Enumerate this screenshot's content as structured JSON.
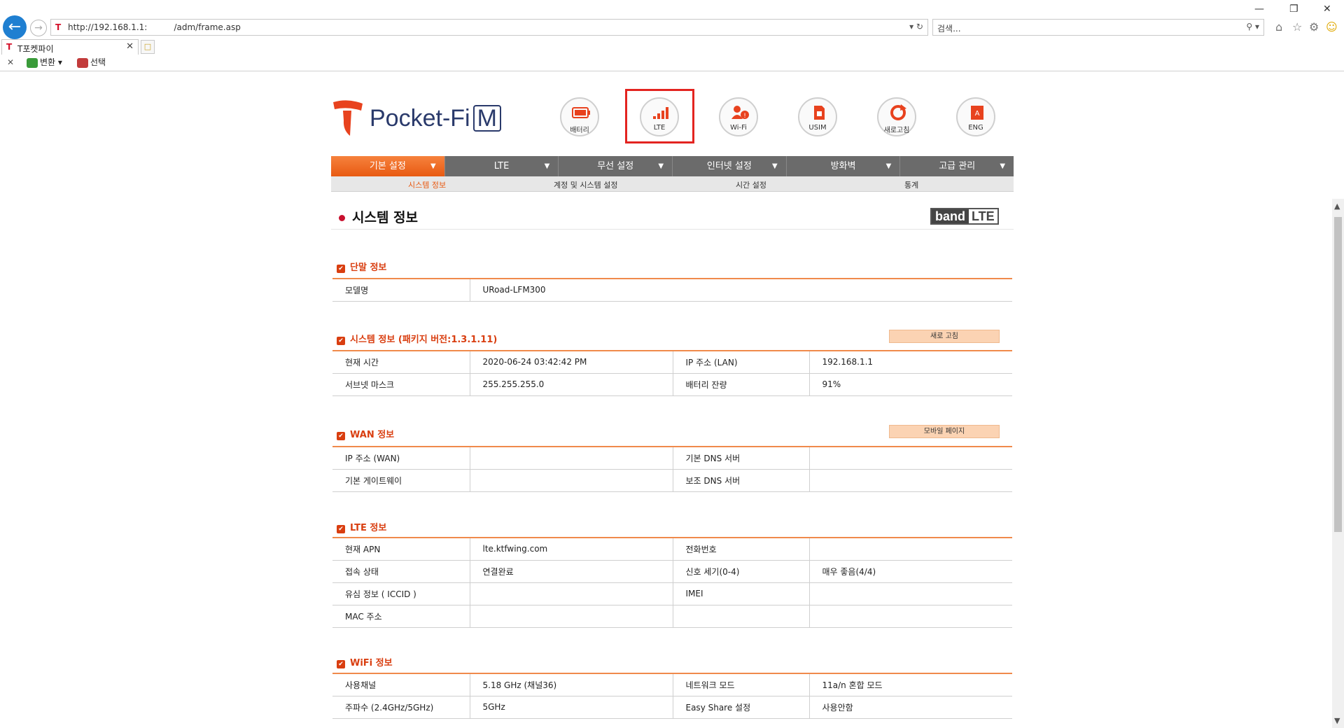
{
  "browser": {
    "url": "http://192.168.1.1:          /adm/frame.asp",
    "search_placeholder": "검색...",
    "tab_title": "T포켓파이",
    "cmd_convert": "변환",
    "cmd_select": "선택"
  },
  "header": {
    "brand": "Pocket-Fi",
    "brand_suffix": "M",
    "quick_icons": [
      {
        "label": "배터리",
        "icon": "battery-icon"
      },
      {
        "label": "LTE",
        "icon": "signal-icon"
      },
      {
        "label": "Wi-Fi",
        "icon": "wifi-users-icon"
      },
      {
        "label": "USIM",
        "icon": "sim-card-icon"
      },
      {
        "label": "새로고침",
        "icon": "refresh-icon"
      },
      {
        "label": "ENG",
        "icon": "language-icon"
      }
    ]
  },
  "nav": {
    "items": [
      "기본 설정",
      "LTE",
      "무선 설정",
      "인터넷 설정",
      "방화벽",
      "고급 관리"
    ],
    "arrow": "▼",
    "sub_items": [
      "시스템 정보",
      "계정 및 시스템 설정",
      "시간 설정",
      "통계"
    ]
  },
  "page": {
    "title": "시스템 정보",
    "badge_band": "band",
    "badge_lte": "LTE"
  },
  "sections": {
    "device": {
      "title": "단말 정보",
      "rows": [
        [
          "모델명",
          "URoad-LFM300"
        ]
      ]
    },
    "system": {
      "title": "시스템 정보 (패키지 버전:1.3.1.11)",
      "button": "새로 고침",
      "rows": [
        [
          "현재 시간",
          "2020-06-24 03:42:42 PM",
          "IP 주소 (LAN)",
          "192.168.1.1"
        ],
        [
          "서브넷 마스크",
          "255.255.255.0",
          "배터리 잔량",
          "91%"
        ]
      ]
    },
    "wan": {
      "title": "WAN 정보",
      "button": "모바일 페이지",
      "rows": [
        [
          "IP 주소 (WAN)",
          "",
          "기본 DNS 서버",
          ""
        ],
        [
          "기본 게이트웨이",
          "",
          "보조 DNS 서버",
          ""
        ]
      ]
    },
    "lte": {
      "title": "LTE 정보",
      "rows": [
        [
          "현재 APN",
          "lte.ktfwing.com",
          "전화번호",
          ""
        ],
        [
          "접속 상태",
          "연결완료",
          "신호 세기(0-4)",
          "매우 좋음(4/4)"
        ],
        [
          "유심 정보 ( ICCID )",
          "",
          "IMEI",
          ""
        ],
        [
          "MAC 주소",
          "",
          "",
          ""
        ]
      ]
    },
    "wifi": {
      "title": "WiFi 정보",
      "rows": [
        [
          "사용채널",
          "5.18 GHz (채널36)",
          "네트워크 모드",
          "11a/n 혼합 모드"
        ],
        [
          "주파수 (2.4GHz/5GHz)",
          "5GHz",
          "Easy Share 설정",
          "사용안함"
        ]
      ]
    }
  },
  "colors": {
    "accent": "#e85a12",
    "section_title": "#d93e10",
    "nav_bg": "#6b6b6b",
    "highlight_box": "#e32420"
  }
}
